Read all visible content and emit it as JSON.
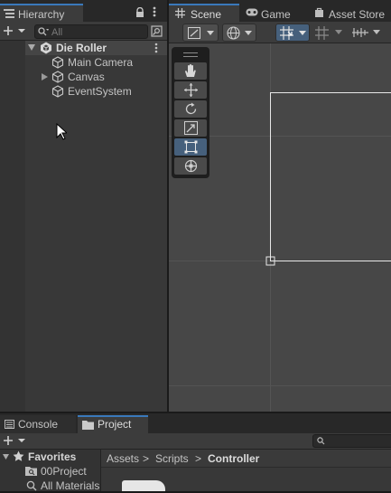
{
  "hierarchy": {
    "tab_label": "Hierarchy",
    "search_placeholder": "All",
    "scene_name": "Die Roller",
    "items": [
      {
        "label": "Main Camera",
        "expandable": false
      },
      {
        "label": "Canvas",
        "expandable": true
      },
      {
        "label": "EventSystem",
        "expandable": false
      }
    ]
  },
  "scene": {
    "tabs": [
      {
        "label": "Scene",
        "icon": "grid-icon",
        "active": true
      },
      {
        "label": "Game",
        "icon": "gamepad-icon",
        "active": false
      },
      {
        "label": "Asset Store",
        "icon": "bag-icon",
        "active": false
      }
    ],
    "tools": [
      {
        "name": "hand-tool",
        "icon": "hand-icon",
        "active": false
      },
      {
        "name": "move-tool",
        "icon": "move-icon",
        "active": false
      },
      {
        "name": "rotate-tool",
        "icon": "rotate-icon",
        "active": false
      },
      {
        "name": "scale-tool",
        "icon": "scale-icon",
        "active": false
      },
      {
        "name": "rect-tool",
        "icon": "rect-icon",
        "active": true
      },
      {
        "name": "transform-tool",
        "icon": "transform-icon",
        "active": false
      }
    ]
  },
  "project": {
    "tabs": [
      {
        "label": "Console",
        "icon": "console-icon",
        "active": false
      },
      {
        "label": "Project",
        "icon": "folder-icon",
        "active": true
      }
    ],
    "favorites_label": "Favorites",
    "favorites": [
      "00Project",
      "All Materials"
    ],
    "breadcrumb": [
      "Assets",
      "Scripts",
      "Controller"
    ],
    "breadcrumb_separator": ">"
  },
  "colors": {
    "accent": "#3a79bb",
    "active_tool": "#46607c",
    "panel": "#383838",
    "scene_bg": "#474747"
  }
}
